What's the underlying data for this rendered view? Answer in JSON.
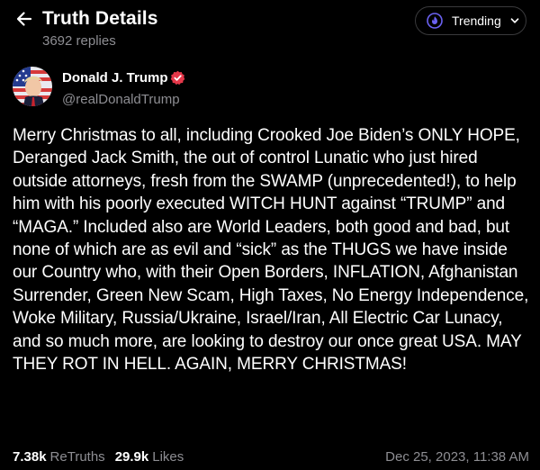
{
  "header": {
    "title": "Truth Details",
    "replies": "3692 replies",
    "trending_label": "Trending"
  },
  "author": {
    "name": "Donald J. Trump",
    "handle": "@realDonaldTrump",
    "verified": true
  },
  "post": {
    "text": "Merry Christmas to all, including Crooked Joe Biden’s ONLY HOPE, Deranged Jack Smith, the out of control Lunatic who just hired outside attorneys, fresh from the SWAMP (unprecedented!), to help him with his poorly executed WITCH HUNT against “TRUMP” and “MAGA.” Included also are World Leaders, both good and bad, but none of which are as evil and “sick” as the THUGS we have inside our Country who, with their Open Borders, INFLATION, Afghanistan Surrender, Green New Scam, High Taxes, No Energy Independence, Woke Military, Russia/Ukraine, Israel/Iran, All Electric Car Lunacy, and so much more, are looking to destroy our once great USA. MAY THEY ROT IN HELL. AGAIN, MERRY CHRISTMAS!"
  },
  "stats": {
    "retruths_count": "7.38k",
    "retruths_label": "ReTruths",
    "likes_count": "29.9k",
    "likes_label": "Likes",
    "timestamp": "Dec 25, 2023, 11:38 AM"
  },
  "icons": {
    "back": "arrow-left-icon",
    "trending": "flame-icon",
    "dropdown": "chevron-down-icon",
    "verified": "verified-badge-icon"
  },
  "colors": {
    "background": "#000000",
    "text": "#ffffff",
    "muted": "#8e8e93",
    "accent": "#5448ee",
    "verified": "#e5384a"
  }
}
